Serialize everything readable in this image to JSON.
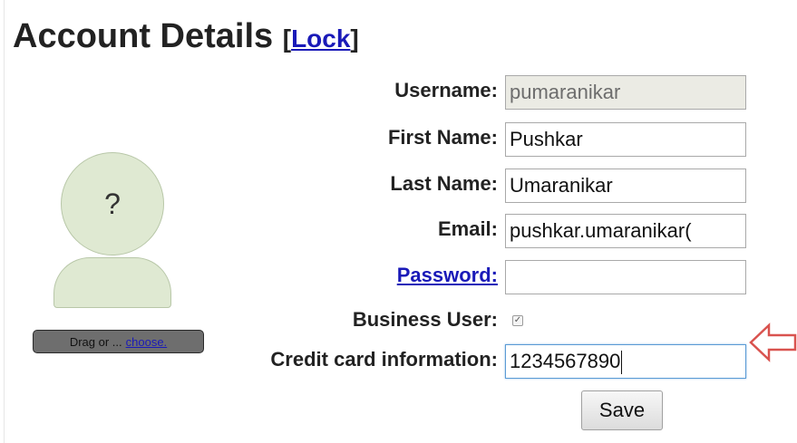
{
  "header": {
    "title": "Account Details",
    "bracket_open": "[",
    "lock_link": "Lock",
    "bracket_close": "]"
  },
  "avatar": {
    "placeholder": "?",
    "drop_text": "Drag or ...",
    "choose_link": "choose."
  },
  "form": {
    "username_label": "Username:",
    "username_value": "pumaranikar",
    "first_name_label": "First Name:",
    "first_name_value": "Pushkar",
    "last_name_label": "Last Name:",
    "last_name_value": "Umaranikar",
    "email_label": "Email:",
    "email_value": "pushkar.umaranikar(",
    "password_label": "Password:",
    "password_value": "",
    "business_user_label": "Business User:",
    "business_user_checked": true,
    "credit_card_label": "Credit card information:",
    "credit_card_value": "1234567890",
    "save_label": "Save"
  },
  "colors": {
    "link": "#1a1ab8",
    "avatar_fill": "#dfe9d2",
    "arrow": "#d9534f",
    "focus_border": "#5b9bd5"
  },
  "icons": {
    "arrow": "left-arrow-outline-icon",
    "checkbox": "checkmark-icon"
  }
}
